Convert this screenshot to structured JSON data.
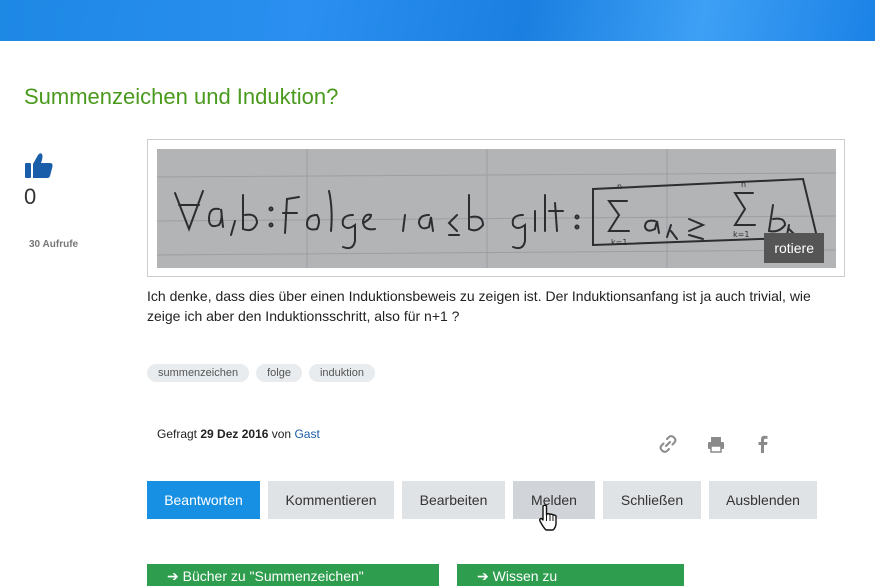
{
  "question": {
    "title": "Summenzeichen und Induktion?",
    "votes": "0",
    "views": "30 Aufrufe",
    "image_button": "rotiere",
    "body": " Ich denke, dass dies über einen Induktionsbeweis zu zeigen ist. Der Induktionsanfang ist ja auch trivial, wie zeige ich aber den Induktionsschritt, also für n+1 ?",
    "tags": [
      "summenzeichen",
      "folge",
      "induktion"
    ],
    "meta": {
      "prefix": "Gefragt ",
      "date": "29 Dez 2016",
      "by": " von ",
      "user": "Gast"
    }
  },
  "share_icons": [
    "link-icon",
    "print-icon",
    "facebook-icon"
  ],
  "actions": [
    "Beantworten",
    "Kommentieren",
    "Bearbeiten",
    "Melden",
    "Schließen",
    "Ausblenden"
  ],
  "related": [
    "➔ Bücher zu \"Summenzeichen\" anschauen",
    "➔ Wissen zu \"Summenzeichen\""
  ],
  "colors": {
    "title": "#4a9a1e",
    "primary": "#1790e3",
    "green": "#2e9e4e",
    "topbar": "#1e88e5"
  }
}
